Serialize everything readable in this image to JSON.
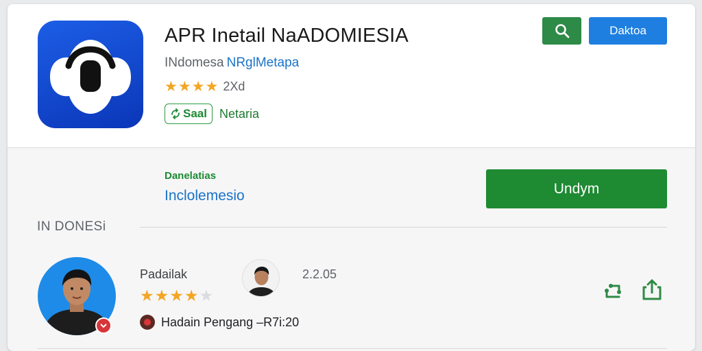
{
  "app": {
    "title": "APR Inetail NaADOMIESIA",
    "developer": "INdomesa",
    "developer_link": "NRglMetapa",
    "stars": "★★★★",
    "rating_text": "2Xd",
    "badge": "Saal",
    "badge_caption": "Netaria",
    "icon": "app-logo-icon"
  },
  "toolbar": {
    "search_icon": "search-icon",
    "primary_label": "Daktoa"
  },
  "details": {
    "label": "Danelatias",
    "value": "Inclolemesio",
    "install_label": "Undym"
  },
  "section": {
    "label": "IN DONESi"
  },
  "review": {
    "author": "Padailak",
    "rating": 3.5,
    "stars_on": "★★★★",
    "stars_off": "★",
    "date": "2.2.05",
    "reply": "Hadain Pengang –R7i:20",
    "actions": [
      "share-icon",
      "upload-icon"
    ]
  },
  "colors": {
    "accent_green": "#1e8a32",
    "accent_blue": "#1e7fe0",
    "star": "#f3a623",
    "link_blue": "#1a73c8"
  }
}
